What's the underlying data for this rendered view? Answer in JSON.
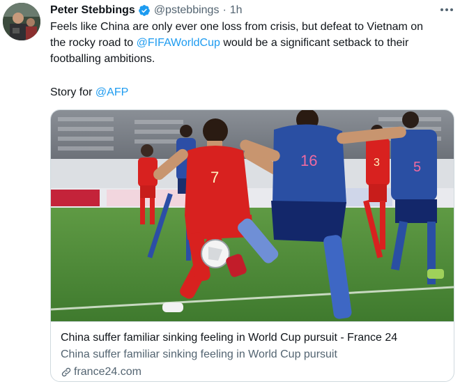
{
  "tweet": {
    "author_name": "Peter Stebbings",
    "handle": "@pstebbings",
    "separator": "·",
    "time": "1h",
    "text_line1": "Feels like China are only ever one loss from crisis, but defeat to Vietnam on",
    "text_line2_before": "the rocky road to ",
    "text_line2_link": "@FIFAWorldCup",
    "text_line2_after": " would be a significant setback to their",
    "text_line3": "footballing ambitions.",
    "story_prefix": "Story for ",
    "story_link": "@AFP"
  },
  "card": {
    "title": "China suffer familiar sinking feeling in World Cup pursuit - France 24",
    "description": "China suffer familiar sinking feeling in World Cup pursuit",
    "domain": "france24.com",
    "image": {
      "player_red_number": "7",
      "player_blue_number": "16",
      "player_right_number": "5",
      "player_bg_number": "3"
    }
  },
  "icons": {
    "verified": "verified-badge-icon",
    "more": "more-options-icon",
    "link": "link-icon"
  },
  "colors": {
    "link": "#1d9bf0",
    "text": "#0f1419",
    "secondary": "#536471",
    "china_red": "#d8211f",
    "japan_blue": "#2a4fa3",
    "pitch": "#4f8e3a"
  }
}
